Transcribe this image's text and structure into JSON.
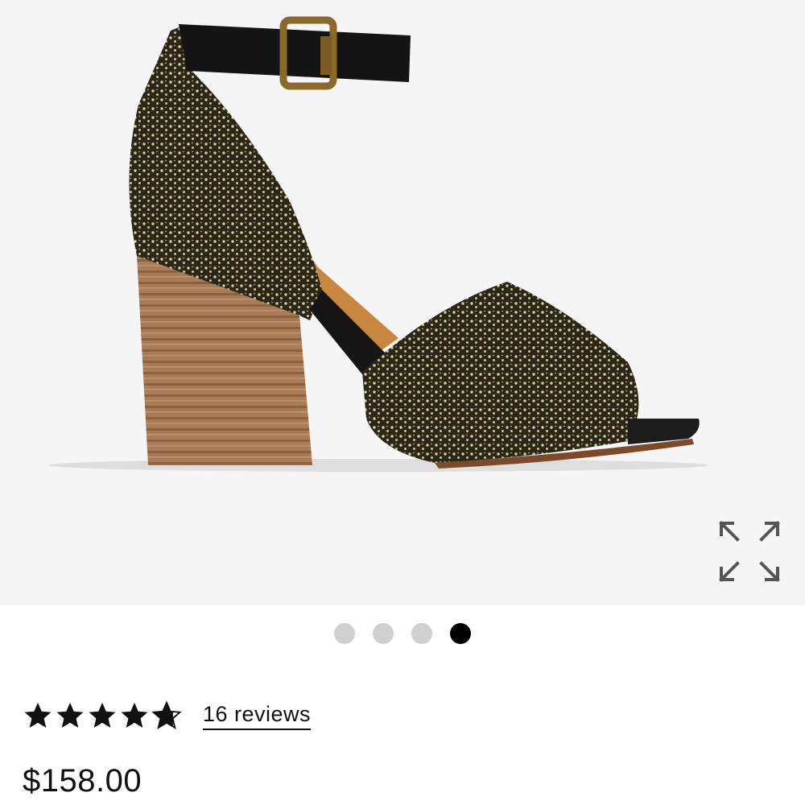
{
  "product": {
    "image_alt": "Ankle strap sandal with speckled calf hair upper and stacked wooden block heel",
    "expand_icon": "expand-arrows-icon"
  },
  "carousel": {
    "count": 4,
    "active_index": 3
  },
  "rating": {
    "stars": 5,
    "value": 4.8,
    "reviews_label": "16 reviews"
  },
  "price": "$158.00",
  "colors": {
    "image_bg": "#f5f5f5",
    "dot_inactive": "#cfcfcf",
    "dot_active": "#000000",
    "text": "#111111"
  }
}
